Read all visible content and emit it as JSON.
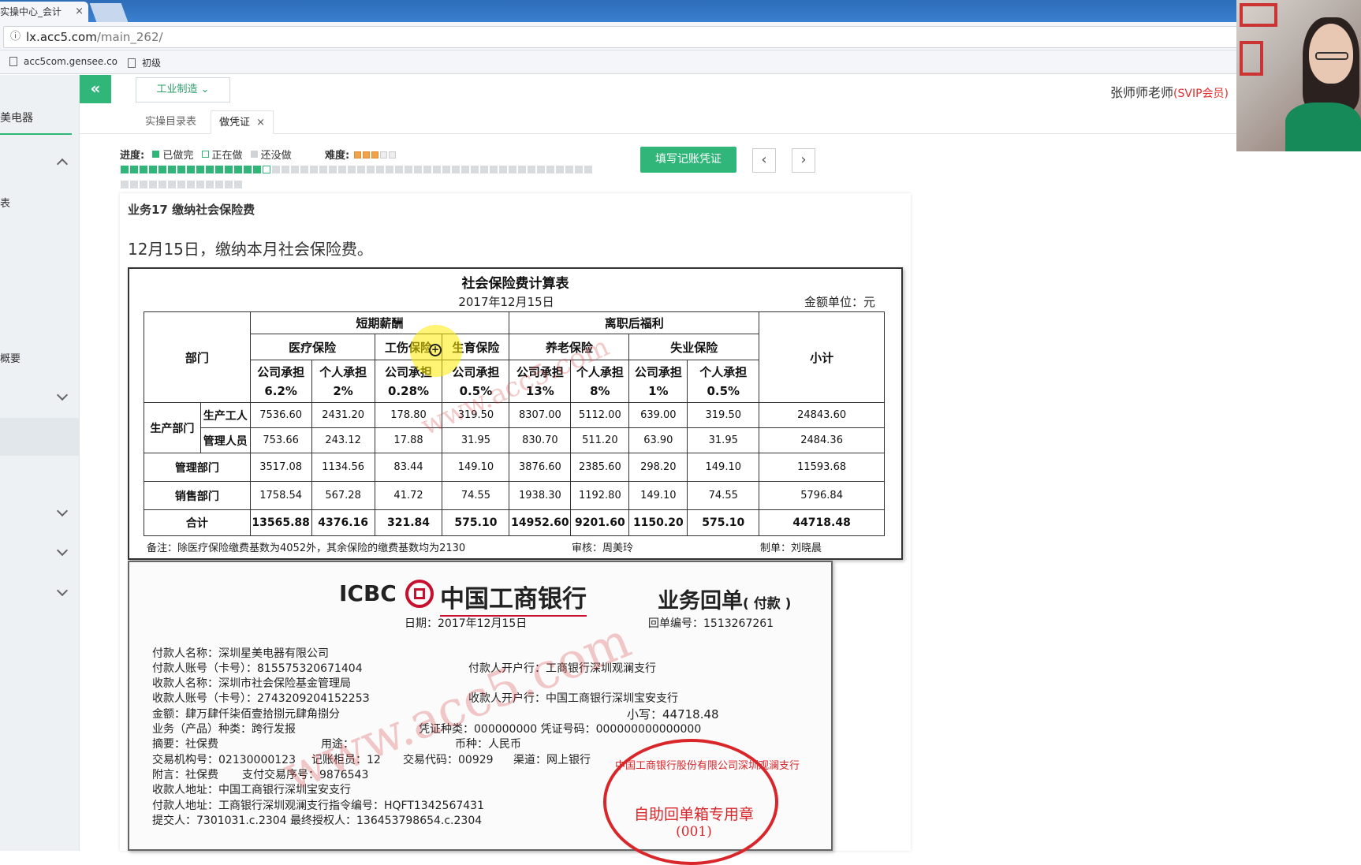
{
  "browser": {
    "tab_title": "实操中心_会计",
    "tab_close": "×",
    "url_host": "lx.acc5.com",
    "url_path": "/main_262/",
    "bookmarks": [
      "acc5com.gensee.co",
      "初级"
    ]
  },
  "sidebar": {
    "top_label": "美电器",
    "items": [
      "表",
      "概要"
    ]
  },
  "header": {
    "collapse_glyph": "«",
    "industry_label": "工业制造 ⌄",
    "user_name": "张师师老师",
    "user_level": "(SVIP会员)"
  },
  "tabs": [
    {
      "label": "实操目录表"
    },
    {
      "label": "做凭证",
      "close": "×"
    }
  ],
  "progress": {
    "label": "进度:",
    "legend_done": "已做完",
    "legend_doing": "正在做",
    "legend_todo": "还没做",
    "done_count": 15,
    "current_index": 16,
    "total_count": 63,
    "colors": {
      "done": "#31b67a",
      "todo": "#d9dcdf"
    }
  },
  "difficulty": {
    "label": "难度:",
    "stars_on": 3,
    "stars_total": 5
  },
  "actions": {
    "fill_voucher": "填写记账凭证",
    "prev": "‹",
    "next": "›"
  },
  "business": {
    "title": "业务17 缴纳社会保险费",
    "description": "12月15日，缴纳本月社会保险费。"
  },
  "insurance_sheet": {
    "title": "社会保险费计算表",
    "date": "2017年12月15日",
    "unit": "金额单位：元",
    "dept_header": "部门",
    "group_short": "短期薪酬",
    "group_post": "离职后福利",
    "subtotal_header": "小计",
    "types": [
      "医疗保险",
      "工伤保险",
      "生育保险",
      "养老保险",
      "失业保险"
    ],
    "company_bear": "公司承担",
    "person_bear": "个人承担",
    "rates": [
      "6.2%",
      "2%",
      "0.28%",
      "0.5%",
      "13%",
      "8%",
      "1%",
      "0.5%"
    ],
    "production_group": "生产部门",
    "rows": [
      {
        "name": "生产工人",
        "values": [
          "7536.60",
          "2431.20",
          "178.80",
          "319.50",
          "8307.00",
          "5112.00",
          "639.00",
          "319.50",
          "24843.60"
        ]
      },
      {
        "name": "管理人员",
        "values": [
          "753.66",
          "243.12",
          "17.88",
          "31.95",
          "830.70",
          "511.20",
          "63.90",
          "31.95",
          "2484.36"
        ]
      },
      {
        "name": "管理部门",
        "values": [
          "3517.08",
          "1134.56",
          "83.44",
          "149.10",
          "3876.60",
          "2385.60",
          "298.20",
          "149.10",
          "11593.68"
        ]
      },
      {
        "name": "销售部门",
        "values": [
          "1758.54",
          "567.28",
          "41.72",
          "74.55",
          "1938.30",
          "1192.80",
          "149.10",
          "74.55",
          "5796.84"
        ]
      }
    ],
    "total": {
      "name": "合计",
      "values": [
        "13565.88",
        "4376.16",
        "321.84",
        "575.10",
        "14952.60",
        "9201.60",
        "1150.20",
        "575.10",
        "44718.48"
      ]
    },
    "note": "备注：除医疗保险缴费基数为4052外，其余保险的缴费基数均为2130",
    "audit": "审核：周美玲",
    "maker": "制单：刘晓晨"
  },
  "receipt": {
    "icbc": "ICBC",
    "bank_name": "中国工商银行",
    "title": "业务回单",
    "title_sub": "( 付款 )",
    "date": "日期：2017年12月15日",
    "receipt_no": "回单编号：1513267261",
    "lines_left": [
      "付款人名称：深圳星美电器有限公司",
      "付款人账号（卡号）：815575320671404",
      "收款人名称：深圳市社会保险基金管理局",
      "收款人账号（卡号）：274320920415225З",
      "金额：肆万肆仟柒佰壹拾捌元肆角捌分",
      "业务（产品）种类：跨行发报",
      "摘要：社保费",
      "交易机构号：02130000123",
      "附言：社保费",
      "收款人地址：中国工商银行深圳宝安支行",
      "付款人地址：工商银行深圳观澜支行指令编号：HQFT1342567431",
      "提交人：7301031.c.2304 最终授权人：136453798654.c.2304"
    ],
    "payer_bank": "付款人开户行：工商银行深圳观澜支行",
    "payee_bank": "收款人开户行：中国工商银行深圳宝安支行",
    "amount_small": "小写：44718.48",
    "voucher_kind": "凭证种类：000000000 凭证号码：000000000000000",
    "usage": "用途：",
    "currency": "币种：人民币",
    "ledger_cabinet": "记账柜员：12",
    "trade_code": "交易代码：00929",
    "channel": "渠道：网上银行",
    "pay_seq": "支付交易序号：9876543"
  },
  "stamp": {
    "top": "中国工商银行股份有限公司深圳观澜支行",
    "middle": "自助回单箱专用章",
    "number": "(001)"
  },
  "watermark": "www.acc5.com"
}
